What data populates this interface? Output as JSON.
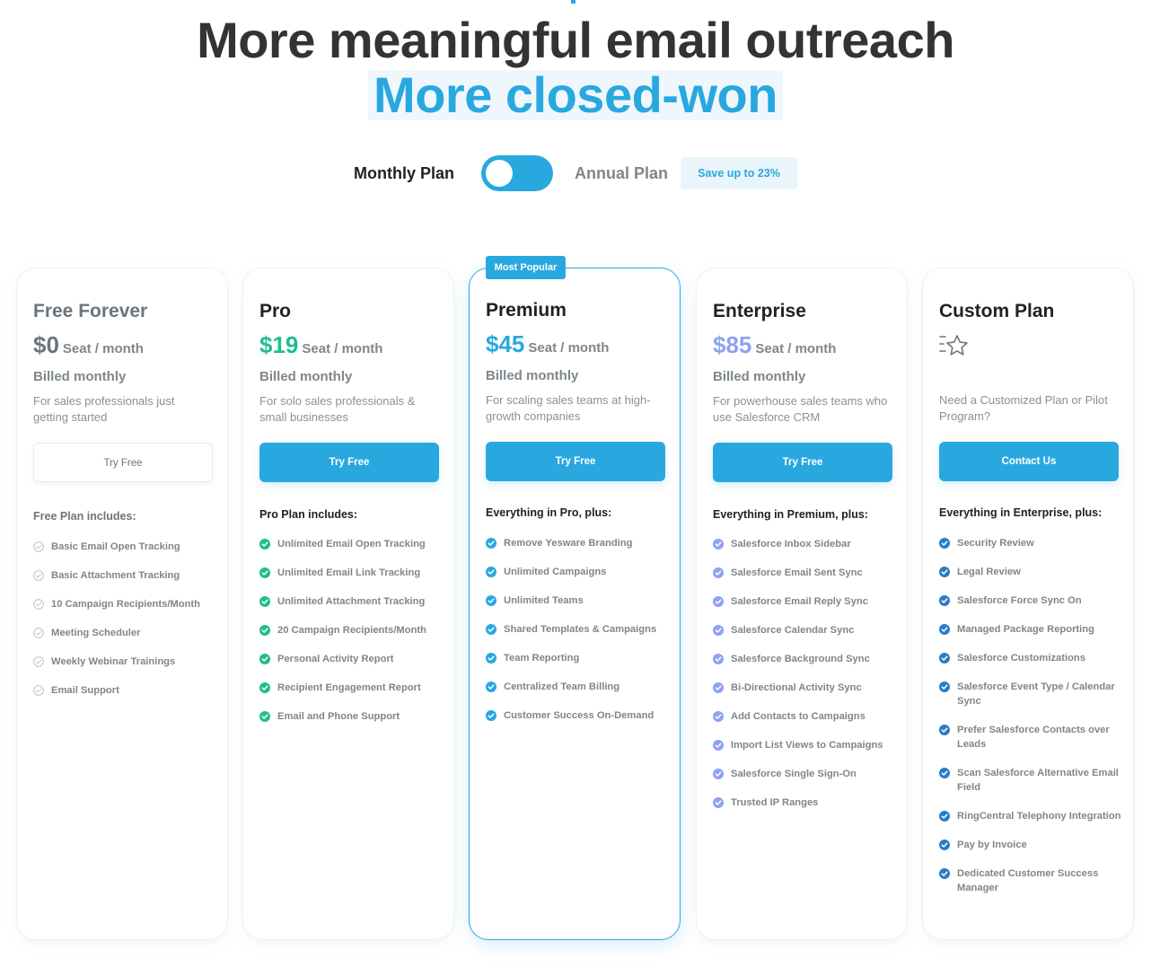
{
  "hero": {
    "title_line1": "More meaningful email outreach",
    "title_line2": "More closed-won"
  },
  "billing_toggle": {
    "monthly_label": "Monthly Plan",
    "annual_label": "Annual Plan",
    "selected": "monthly",
    "save_badge": "Save up to 23%"
  },
  "colors": {
    "accent": "#29a8e0",
    "pro_green": "#1fbe8f",
    "enterprise_periwinkle": "#8ea2f2",
    "custom_navy_blue": "#2a7dc4",
    "muted_text": "#7e868c",
    "heading": "#333333"
  },
  "plans": [
    {
      "name": "Free Forever",
      "price": "$0",
      "per": "Seat / month",
      "billed": "Billed monthly",
      "description": "For sales professionals just getting started",
      "cta": "Try Free",
      "includes_title": "Free Plan includes:",
      "check_style": "outline-gray",
      "features": [
        "Basic Email Open Tracking",
        "Basic Attachment Tracking",
        "10 Campaign Recipients/Month",
        "Meeting Scheduler",
        "Weekly Webinar Trainings",
        "Email Support"
      ]
    },
    {
      "name": "Pro",
      "price": "$19",
      "per": "Seat / month",
      "billed": "Billed monthly",
      "description": "For solo sales professionals & small businesses",
      "cta": "Try Free",
      "includes_title": "Pro Plan includes:",
      "check_style": "filled-green",
      "features": [
        "Unlimited Email Open Tracking",
        "Unlimited Email Link Tracking",
        "Unlimited Attachment Tracking",
        "20 Campaign Recipients/Month",
        "Personal Activity Report",
        "Recipient Engagement Report",
        "Email and Phone Support"
      ]
    },
    {
      "name": "Premium",
      "badge": "Most Popular",
      "price": "$45",
      "per": "Seat / month",
      "billed": "Billed monthly",
      "description": "For scaling sales teams at high-growth companies",
      "cta": "Try Free",
      "includes_title": "Everything in Pro, plus:",
      "check_style": "filled-blue",
      "features": [
        "Remove Yesware Branding",
        "Unlimited Campaigns",
        "Unlimited Teams",
        "Shared Templates & Campaigns",
        "Team Reporting",
        "Centralized Team Billing",
        "Customer Success On-Demand"
      ]
    },
    {
      "name": "Enterprise",
      "price": "$85",
      "per": "Seat / month",
      "billed": "Billed monthly",
      "description": "For powerhouse sales teams who use Salesforce CRM",
      "cta": "Try Free",
      "includes_title": "Everything in Premium, plus:",
      "check_style": "filled-periwinkle",
      "features": [
        "Salesforce Inbox Sidebar",
        "Salesforce Email Sent Sync",
        "Salesforce Email Reply Sync",
        "Salesforce Calendar Sync",
        "Salesforce Background Sync",
        "Bi-Directional Activity Sync",
        "Add Contacts to Campaigns",
        "Import List Views to Campaigns",
        "Salesforce Single Sign-On",
        "Trusted IP Ranges"
      ]
    },
    {
      "name": "Custom Plan",
      "icon": "star-speed-icon",
      "description": "Need a Customized Plan or Pilot Program?",
      "cta": "Contact Us",
      "includes_title": "Everything in Enterprise, plus:",
      "check_style": "filled-navy",
      "features": [
        "Security Review",
        "Legal Review",
        "Salesforce Force Sync On",
        "Managed Package Reporting",
        "Salesforce Customizations",
        "Salesforce Event Type / Calendar Sync",
        "Prefer Salesforce Contacts over Leads",
        "Scan Salesforce Alternative Email Field",
        "RingCentral Telephony Integration",
        "Pay by Invoice",
        "Dedicated Customer Success Manager"
      ]
    }
  ]
}
